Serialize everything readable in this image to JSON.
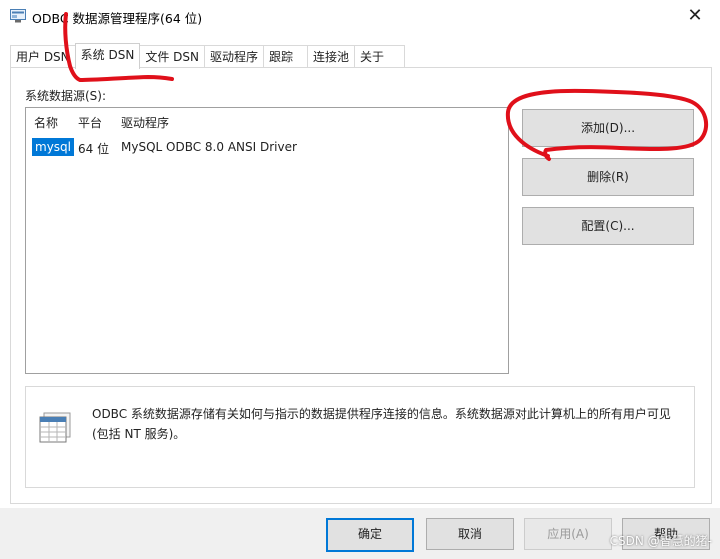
{
  "window": {
    "title": "ODBC 数据源管理程序(64 位)",
    "close_glyph": "✕"
  },
  "tabs": [
    {
      "label": "用户 DSN",
      "active": false
    },
    {
      "label": "系统 DSN",
      "active": true
    },
    {
      "label": "文件 DSN",
      "active": false
    },
    {
      "label": "驱动程序",
      "active": false
    },
    {
      "label": "跟踪",
      "active": false
    },
    {
      "label": "连接池",
      "active": false
    },
    {
      "label": "关于",
      "active": false
    }
  ],
  "system_dsn": {
    "section_label": "系统数据源(S):",
    "columns": [
      "名称",
      "平台",
      "驱动程序"
    ],
    "rows": [
      {
        "name": "mysql",
        "platform": "64 位",
        "driver": "MySQL ODBC 8.0 ANSI Driver",
        "selected": true
      }
    ]
  },
  "actions": {
    "add": "添加(D)...",
    "remove": "删除(R)",
    "configure": "配置(C)..."
  },
  "info": {
    "icon": "database-table-icon",
    "text": "ODBC 系统数据源存储有关如何与指示的数据提供程序连接的信息。系统数据源对此计算机上的所有用户可见(包括 NT 服务)。"
  },
  "footer": {
    "ok": "确定",
    "cancel": "取消",
    "apply": "应用(A)",
    "help": "帮助"
  },
  "watermark": "CSDN @智慧的猪-",
  "colors": {
    "selection": "#0078d7",
    "annotation": "#e0101a"
  }
}
